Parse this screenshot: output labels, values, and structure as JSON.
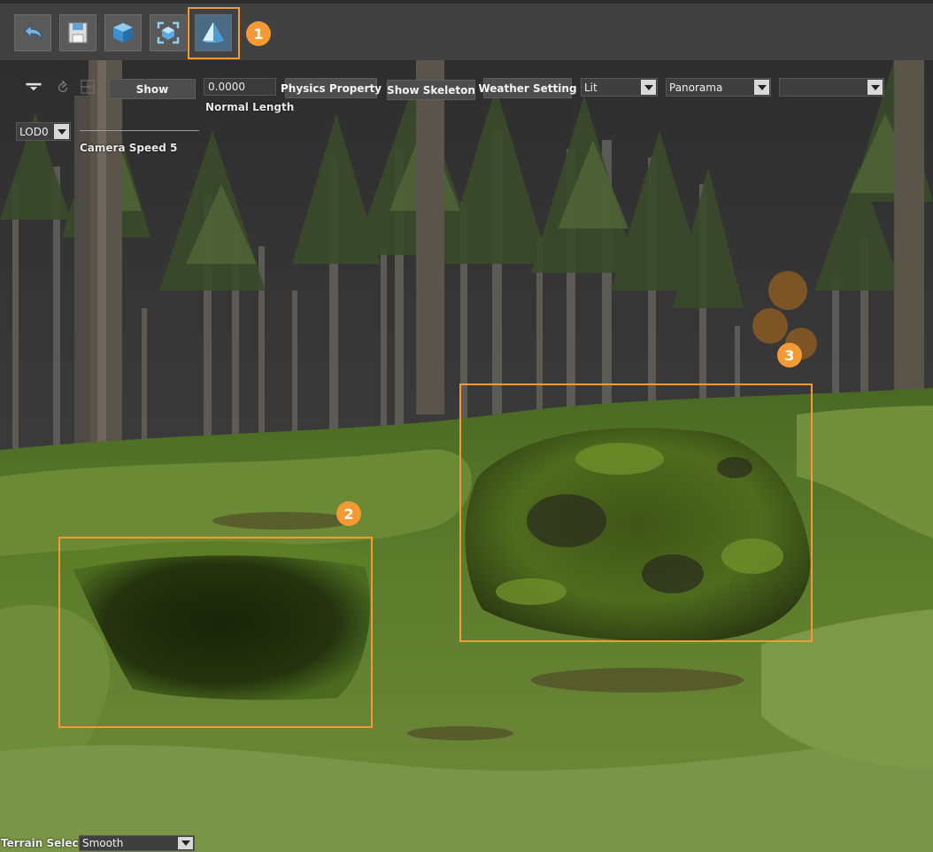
{
  "toolbar": {
    "buttons": [
      {
        "name": "undo-icon"
      },
      {
        "name": "save-icon"
      },
      {
        "name": "cube-icon"
      },
      {
        "name": "focus-icon"
      },
      {
        "name": "terrain-mesh-icon"
      }
    ]
  },
  "callouts": [
    "1",
    "2",
    "3"
  ],
  "viewport_controls": {
    "show_label": "Show",
    "normal_length_value": "0.0000",
    "normal_length_label": "Normal Length",
    "physics_property_label": "Physics Property",
    "show_skeleton_label": "Show Skeleton",
    "weather_setting_label": "Weather Setting",
    "view_mode_value": "Lit",
    "background_value": "Panorama",
    "extra_value": "",
    "lod_value": "LOD0",
    "camera_speed_label": "Camera Speed 5"
  },
  "terrain_select": {
    "label": "Terrain Select:",
    "value": "Smooth"
  },
  "colors": {
    "accent": "#f39a35",
    "toolbar_bg": "#414141",
    "grass": "#5e7a2e",
    "moss": "#4f6b1d"
  }
}
